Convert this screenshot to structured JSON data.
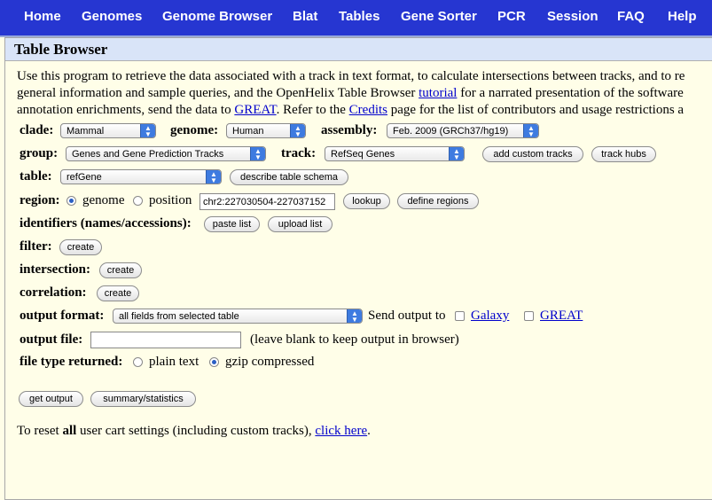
{
  "nav": [
    "Home",
    "Genomes",
    "Genome Browser",
    "Blat",
    "Tables",
    "Gene Sorter",
    "PCR",
    "Session",
    "FAQ",
    "Help"
  ],
  "panel_title": "Table Browser",
  "intro": {
    "line1": "Use this program to retrieve the data associated with a track in text format, to calculate intersections between tracks, and to re",
    "line2_pre": "general information and sample queries, and the OpenHelix Table Browser ",
    "line2_link": "tutorial",
    "line2_post": " for a narrated presentation of the software",
    "line3_pre": "annotation enrichments, send the data to ",
    "line3_link1": "GREAT",
    "line3_mid": ". Refer to the ",
    "line3_link2": "Credits",
    "line3_post": " page for the list of contributors and usage restrictions a"
  },
  "clade": {
    "label": "clade:",
    "value": "Mammal"
  },
  "genome": {
    "label": "genome:",
    "value": "Human"
  },
  "assembly": {
    "label": "assembly:",
    "value": "Feb. 2009 (GRCh37/hg19)"
  },
  "group": {
    "label": "group:",
    "value": "Genes and Gene Prediction Tracks"
  },
  "track": {
    "label": "track:",
    "value": "RefSeq Genes"
  },
  "buttons": {
    "add_custom": "add custom tracks",
    "track_hubs": "track hubs",
    "describe": "describe table schema",
    "lookup": "lookup",
    "define_regions": "define regions",
    "paste_list": "paste list",
    "upload_list": "upload list",
    "filter_create": "create",
    "intersection_create": "create",
    "correlation_create": "create",
    "get_output": "get output",
    "summary": "summary/statistics"
  },
  "table": {
    "label": "table:",
    "value": "refGene"
  },
  "region": {
    "label": "region:",
    "opt_genome": "genome",
    "opt_position": "position",
    "position_value": "chr2:227030504-227037152",
    "selected": "genome"
  },
  "identifiers": {
    "label": "identifiers (names/accessions):"
  },
  "filter": {
    "label": "filter:"
  },
  "intersection": {
    "label": "intersection:"
  },
  "correlation": {
    "label": "correlation:"
  },
  "output_format": {
    "label": "output format:",
    "value": "all fields from selected table",
    "send_label": "Send output to",
    "galaxy": "Galaxy",
    "great": "GREAT"
  },
  "output_file": {
    "label": "output file:",
    "value": "",
    "hint": "(leave blank to keep output in browser)"
  },
  "file_type": {
    "label": "file type returned:",
    "plain": "plain text",
    "gzip": "gzip compressed",
    "selected": "gzip"
  },
  "reset": {
    "pre": "To reset ",
    "bold": "all",
    "mid": " user cart settings (including custom tracks), ",
    "link": "click here",
    "post": "."
  },
  "colors": {
    "nav_bg": "#2636D1",
    "page_bg": "#FFFEE8",
    "title_bg": "#D9E4F8",
    "link": "#0000CC"
  }
}
